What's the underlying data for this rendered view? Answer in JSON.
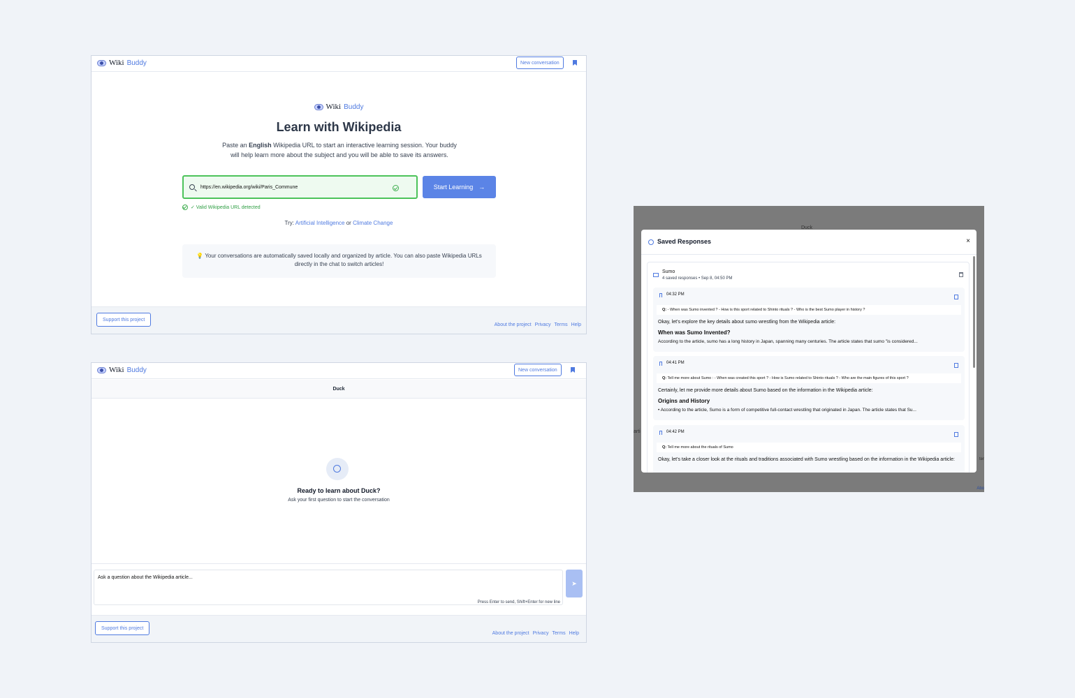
{
  "brand": {
    "wiki": "Wiki",
    "buddy": "Buddy"
  },
  "header": {
    "new_conversation": "New conversation",
    "bookmark_icon": "bookmark-icon"
  },
  "landing": {
    "title": "Learn with Wikipedia",
    "subtitle_pre": "Paste an ",
    "subtitle_bold": "English",
    "subtitle_post": " Wikipedia URL to start an interactive learning session. Your buddy will help learn more about the subject and you will be able to save its answers.",
    "url_value": "https://en.wikipedia.org/wiki/Paris_Commune",
    "start_button": "Start Learning",
    "valid_message": "✓ Valid Wikipedia URL detected",
    "try_label": "Try:",
    "try_link1": "Artificial Intelligence",
    "try_or": "or",
    "try_link2": "Climate Change",
    "note": "💡 Your conversations are automatically saved locally and organized by article. You can also paste Wikipedia URLs directly in the chat to switch articles!"
  },
  "footer": {
    "support": "Support this project",
    "links": [
      "About the project",
      "Privacy",
      "Terms",
      "Help"
    ]
  },
  "chat": {
    "article_title": "Duck",
    "ready": "Ready to learn about Duck?",
    "ask": "Ask your first question to start the conversation",
    "placeholder": "Ask a question about the Wikipedia article...",
    "hint": "Press Enter to send, Shift+Enter for new line",
    "send_icon": "send-icon"
  },
  "saved": {
    "title": "Saved Responses",
    "close": "×",
    "article": "Sumo",
    "meta": "4 saved responses • Sep 8, 04:50 PM",
    "background_texts": {
      "duck": "Duck",
      "left": "arti",
      "right": "ter",
      "bottom": "Abo"
    },
    "responses": [
      {
        "time": "04:32 PM",
        "q_label": "Q:",
        "question": " - When was Sumo invented ? - How is this sport related to Shinto rituals ? - Who is the best Sumo player in history ?",
        "intro": "Okay, let's explore the key details about sumo wrestling from the Wikipedia article:",
        "heading": "When was Sumo Invented?",
        "text": "According to the article, sumo has a long history in Japan, spanning many centuries. The article states that sumo \"is considered..."
      },
      {
        "time": "04:41 PM",
        "q_label": "Q:",
        "question": " Tell me more about Sumo : - When was created this sport ? - How is Sumo related to Shinto rituals ? - Who are the main figures of this sport ?",
        "intro": "Certainly, let me provide more details about Sumo based on the information in the Wikipedia article:",
        "heading": "Origins and History",
        "text": "• According to the article, Sumo is a form of competitive full-contact wrestling that originated in Japan. The article states that Su..."
      },
      {
        "time": "04:42 PM",
        "q_label": "Q:",
        "question": " Tell me more about the rituals of Sumo",
        "intro": "Okay, let's take a closer look at the rituals and traditions associated with Sumo wrestling based on the information in the Wikipedia article:",
        "heading": "",
        "text": ""
      }
    ]
  }
}
